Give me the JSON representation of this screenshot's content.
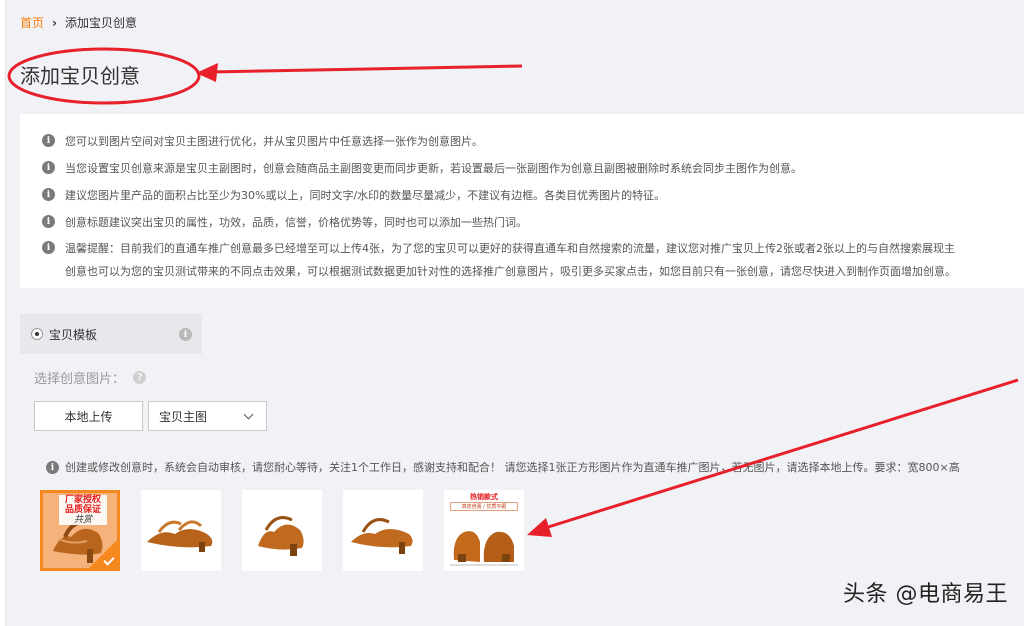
{
  "breadcrumb": {
    "home": "首页",
    "separator": "›",
    "current": "添加宝贝创意"
  },
  "page_title": "添加宝贝创意",
  "notices": [
    "您可以到图片空间对宝贝主图进行优化，并从宝贝图片中任意选择一张作为创意图片。",
    "当您设置宝贝创意来源是宝贝主副图时，创意会随商品主副图变更而同步更新，若设置最后一张副图作为创意且副图被删除时系统会同步主图作为创意。",
    "建议您图片里产品的面积占比至少为30%或以上，同时文字/水印的数量尽量减少，不建议有边框。各类目优秀图片的特征。",
    "创意标题建议突出宝贝的属性，功效，品质，信誉，价格优势等，同时也可以添加一些热门词。",
    "温馨提醒：目前我们的直通车推广创意最多已经增至可以上传4张，为了您的宝贝可以更好的获得直通车和自然搜索的流量，建议您对推广宝贝上传2张或者2张以上的与自然搜索展现主"
  ],
  "notice_continuation": "创意也可以为您的宝贝测试带来的不同点击效果，可以根据测试数据更加针对性的选择推广创意图片，吸引更多买家点击，如您目前只有一张创意，请您尽快进入到制作页面增加创意。",
  "template_tab": {
    "label": "宝贝模板",
    "selected": true
  },
  "select_image_label": "选择创意图片：",
  "upload_button": "本地上传",
  "source_select": {
    "value": "宝贝主图"
  },
  "review_note": "创建或修改创意时，系统会自动审核，请您耐心等待，关注1个工作日，感谢支持和配合！ 请您选择1张正方形图片作为直通车推广图片，若无图片，请选择本地上传。要求：宽800×高",
  "thumbnails": [
    {
      "badge_line1": "厂家授权",
      "badge_line2": "品质保证",
      "signature": "共赏",
      "selected": true
    },
    {
      "selected": false
    },
    {
      "selected": false
    },
    {
      "selected": false
    },
    {
      "top_label": "热销款式",
      "sub_label": "真皮芭蕾 / 优质平跟",
      "selected": false
    }
  ],
  "watermark": "头条 @电商易王",
  "colors": {
    "accent_orange": "#f5891f",
    "link_orange": "#ff7a00",
    "annotation_red": "#e8202a"
  },
  "icons": {
    "info": "info-circle-icon",
    "question": "question-circle-icon",
    "chevron": "chevron-down-icon",
    "check": "check-icon"
  }
}
